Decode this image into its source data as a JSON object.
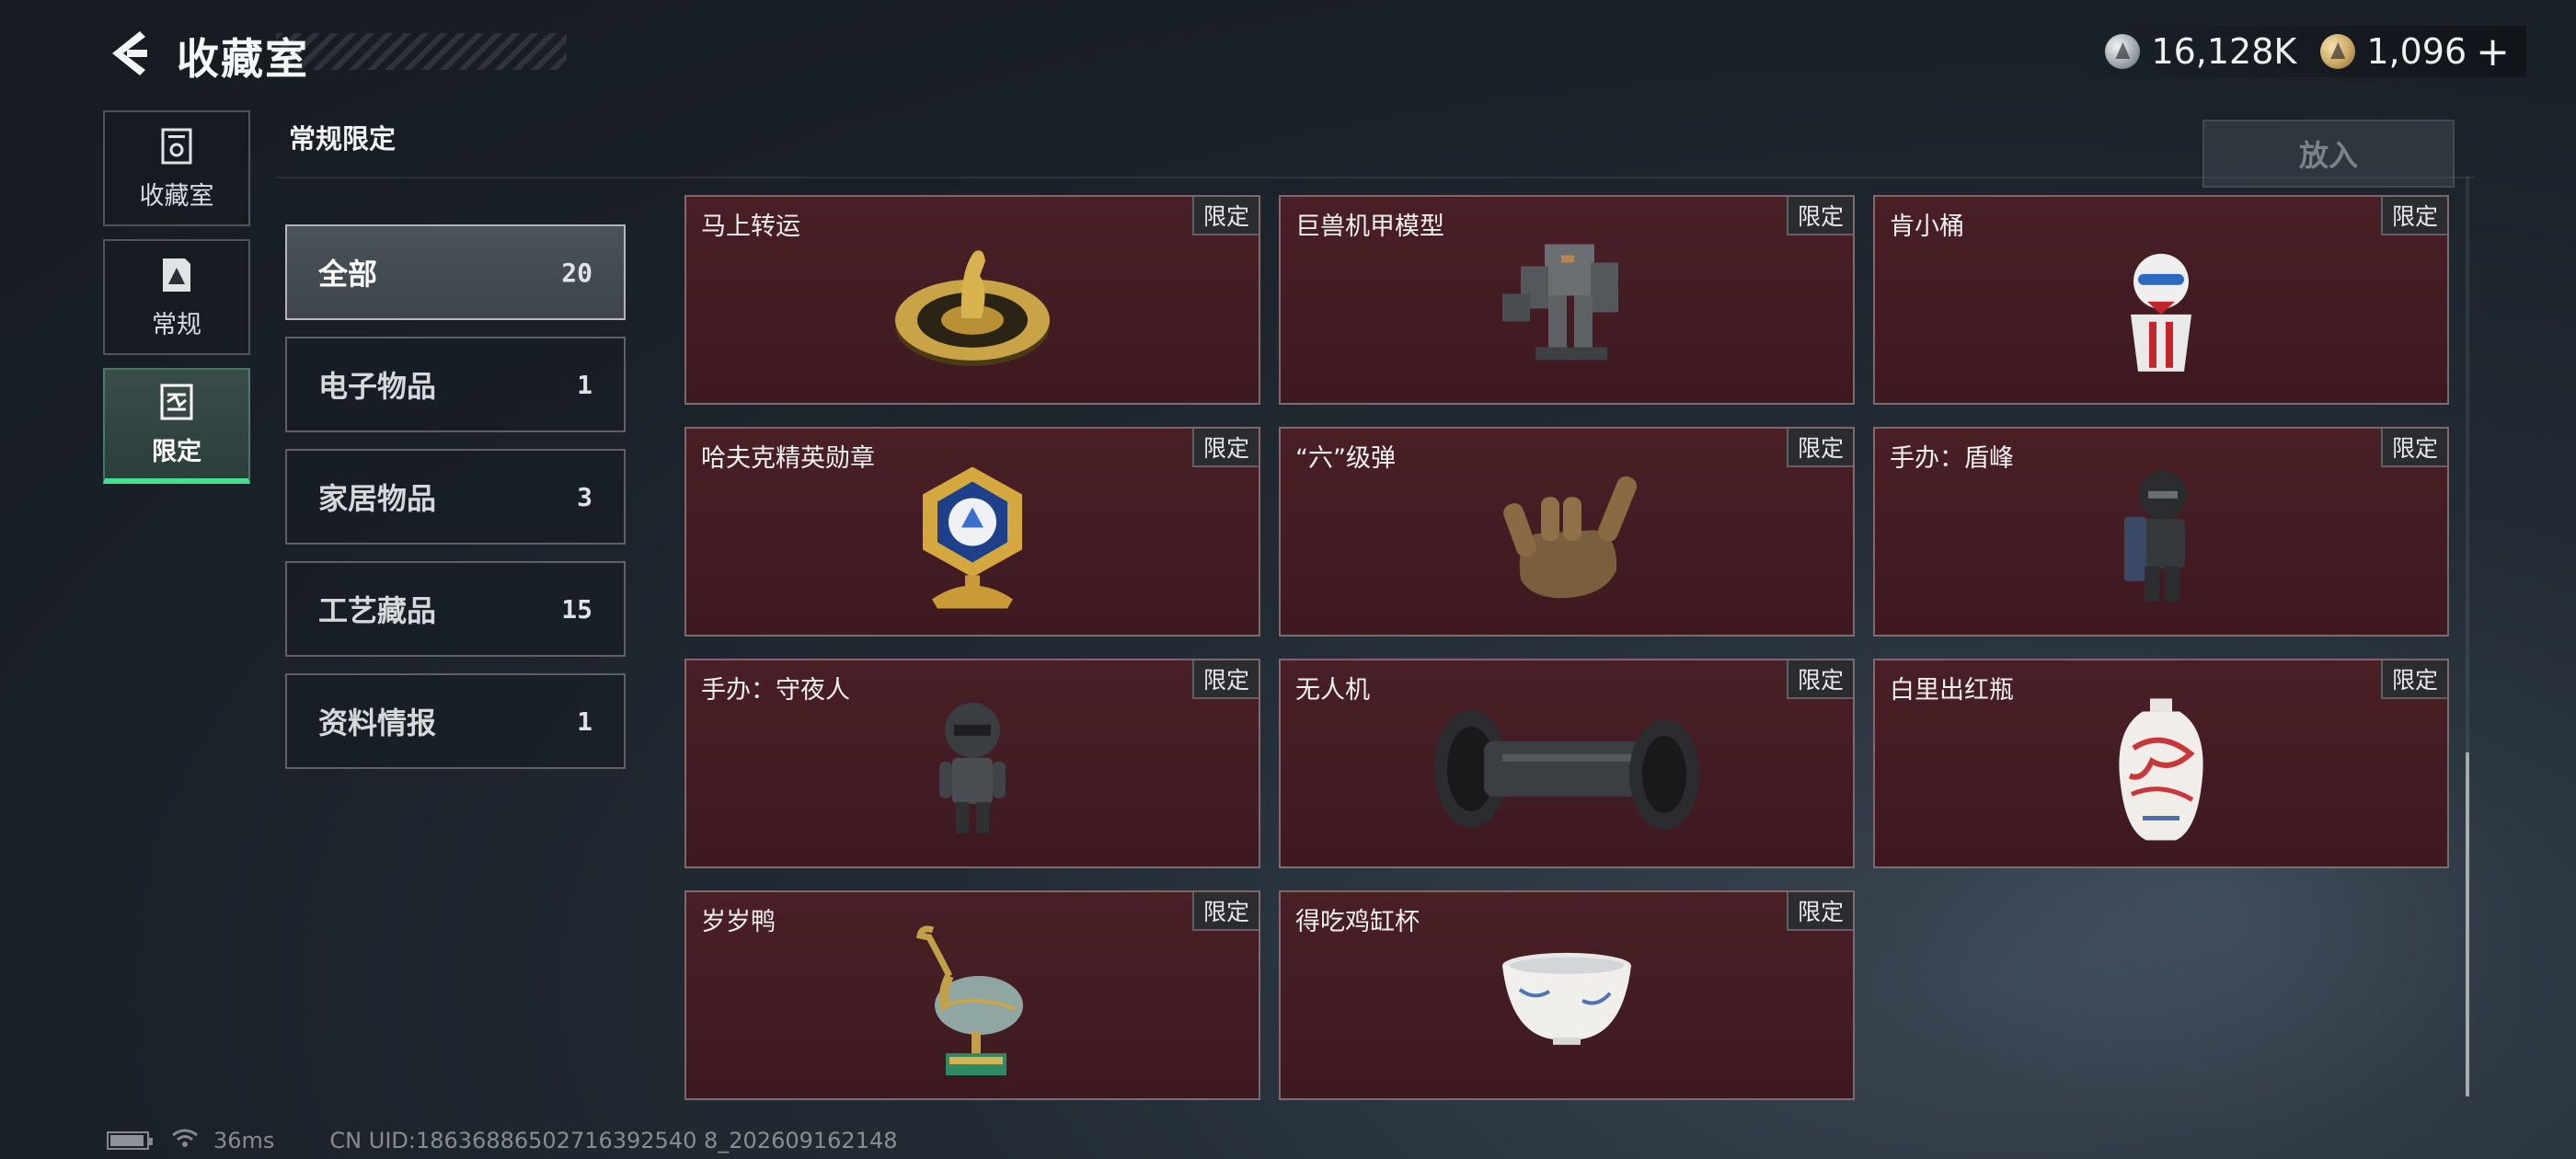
{
  "header": {
    "title": "收藏室",
    "currency": [
      {
        "icon": "silver-coin-icon",
        "value": "16,128K"
      },
      {
        "icon": "gold-coin-icon",
        "value": "1,096"
      }
    ],
    "plus_label": "+"
  },
  "left_nav": [
    {
      "label": "收藏室",
      "icon": "collection-room-icon",
      "active": false
    },
    {
      "label": "常规",
      "icon": "regular-icon",
      "active": false
    },
    {
      "label": "限定",
      "icon": "limited-icon",
      "active": true
    }
  ],
  "section": {
    "title": "常规限定"
  },
  "put_in_button": "放入",
  "categories": [
    {
      "name": "全部",
      "count": "20",
      "active": true
    },
    {
      "name": "电子物品",
      "count": "1",
      "active": false
    },
    {
      "name": "家居物品",
      "count": "3",
      "active": false
    },
    {
      "name": "工艺藏品",
      "count": "15",
      "active": false
    },
    {
      "name": "资料情报",
      "count": "1",
      "active": false
    }
  ],
  "items": [
    {
      "name": "马上转运",
      "tag": "限定",
      "icon": "lucky-horse-disc-icon"
    },
    {
      "name": "巨兽机甲模型",
      "tag": "限定",
      "icon": "mech-model-icon"
    },
    {
      "name": "肯小桶",
      "tag": "限定",
      "icon": "kfc-bucket-figure-icon"
    },
    {
      "name": "哈夫克精英勋章",
      "tag": "限定",
      "icon": "elite-medal-icon"
    },
    {
      "name": "“六”级弹",
      "tag": "限定",
      "icon": "bullet-hand-sculpture-icon"
    },
    {
      "name": "手办：盾峰",
      "tag": "限定",
      "icon": "shield-figure-icon"
    },
    {
      "name": "手办：守夜人",
      "tag": "限定",
      "icon": "nightwatch-figure-icon"
    },
    {
      "name": "无人机",
      "tag": "限定",
      "icon": "drone-icon"
    },
    {
      "name": "白里出红瓶",
      "tag": "限定",
      "icon": "porcelain-vase-icon"
    },
    {
      "name": "岁岁鸭",
      "tag": "限定",
      "icon": "bronze-duck-icon"
    },
    {
      "name": "得吃鸡缸杯",
      "tag": "限定",
      "icon": "porcelain-cup-icon"
    }
  ],
  "footer": {
    "ping": "36ms",
    "uid": "CN UID:18636886502716392540 8_202609162148"
  }
}
